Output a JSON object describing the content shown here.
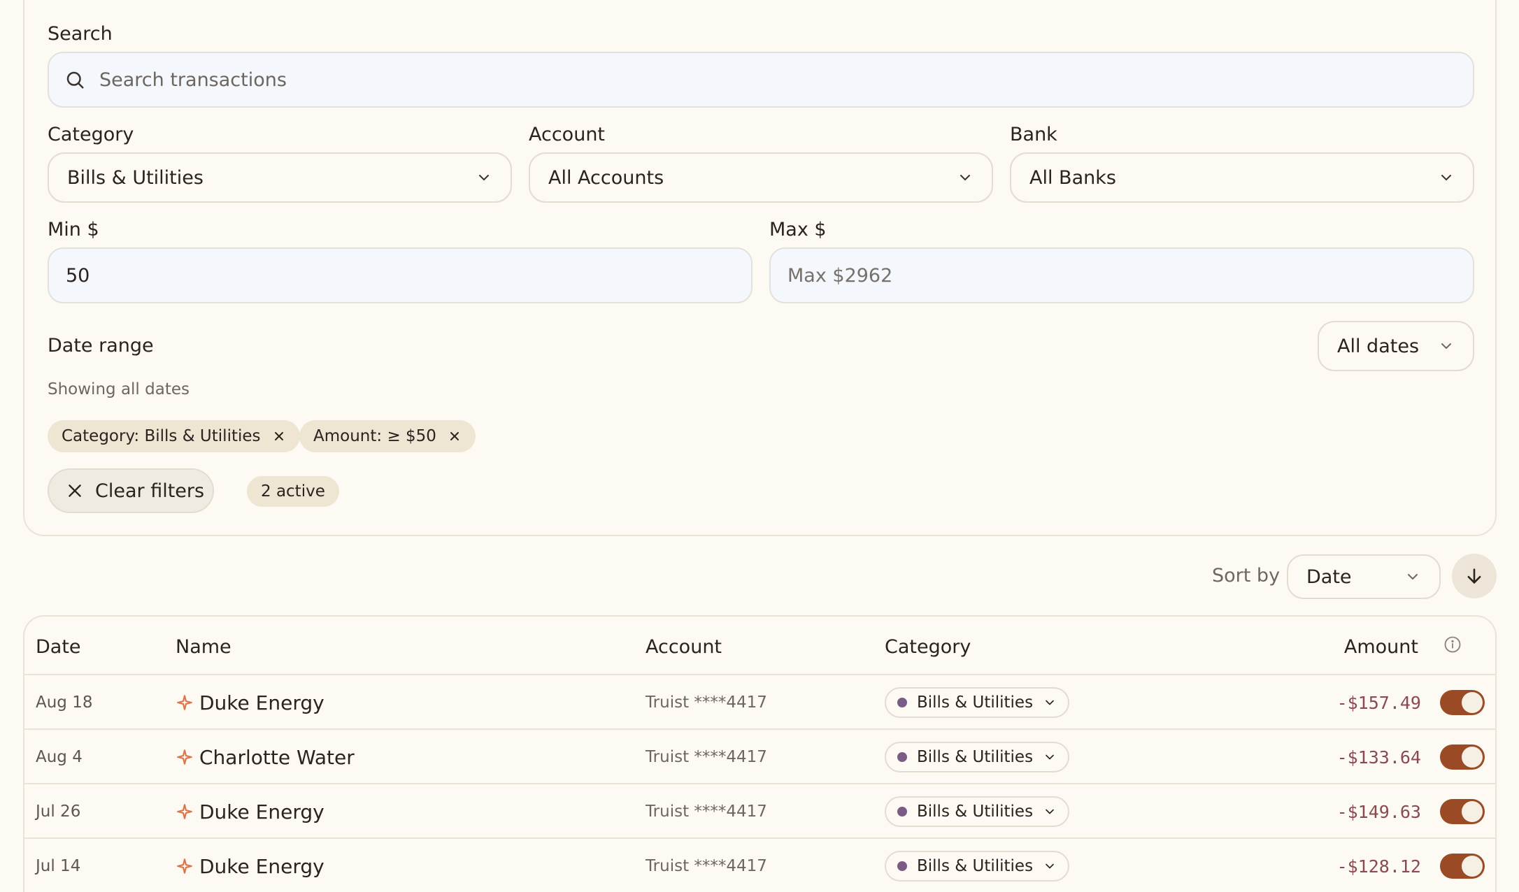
{
  "filters": {
    "search_label": "Search",
    "search_placeholder": "Search transactions",
    "category_label": "Category",
    "category_value": "Bills & Utilities",
    "account_label": "Account",
    "account_value": "All Accounts",
    "bank_label": "Bank",
    "bank_value": "All Banks",
    "min_label": "Min $",
    "min_value": "50",
    "max_label": "Max $",
    "max_placeholder": "Max $2962",
    "date_range_label": "Date range",
    "date_range_value": "All dates",
    "date_range_note": "Showing all dates",
    "chips": [
      {
        "label": "Category: Bills & Utilities"
      },
      {
        "label": "Amount: ≥ $50"
      }
    ],
    "clear_label": "Clear filters",
    "active_count": "2 active"
  },
  "sort": {
    "label": "Sort by",
    "value": "Date"
  },
  "table": {
    "headers": {
      "date": "Date",
      "name": "Name",
      "account": "Account",
      "category": "Category",
      "amount": "Amount"
    },
    "rows": [
      {
        "date": "Aug 18",
        "name": "Duke Energy",
        "account": "Truist ****4417",
        "category": "Bills & Utilities",
        "amount": "-$157.49"
      },
      {
        "date": "Aug 4",
        "name": "Charlotte Water",
        "account": "Truist ****4417",
        "category": "Bills & Utilities",
        "amount": "-$133.64"
      },
      {
        "date": "Jul 26",
        "name": "Duke Energy",
        "account": "Truist ****4417",
        "category": "Bills & Utilities",
        "amount": "-$149.63"
      },
      {
        "date": "Jul 14",
        "name": "Duke Energy",
        "account": "Truist ****4417",
        "category": "Bills & Utilities",
        "amount": "-$128.12"
      }
    ]
  },
  "colors": {
    "background": "#fcfaf3",
    "accent": "#9a4a25",
    "amount": "#8a4a52",
    "category_dot": "#7a5c85",
    "sparkle": "#d9774a"
  },
  "icons": [
    "search-icon",
    "chevron-down-icon",
    "close-icon",
    "arrow-down-icon",
    "info-icon",
    "sparkle-icon"
  ]
}
